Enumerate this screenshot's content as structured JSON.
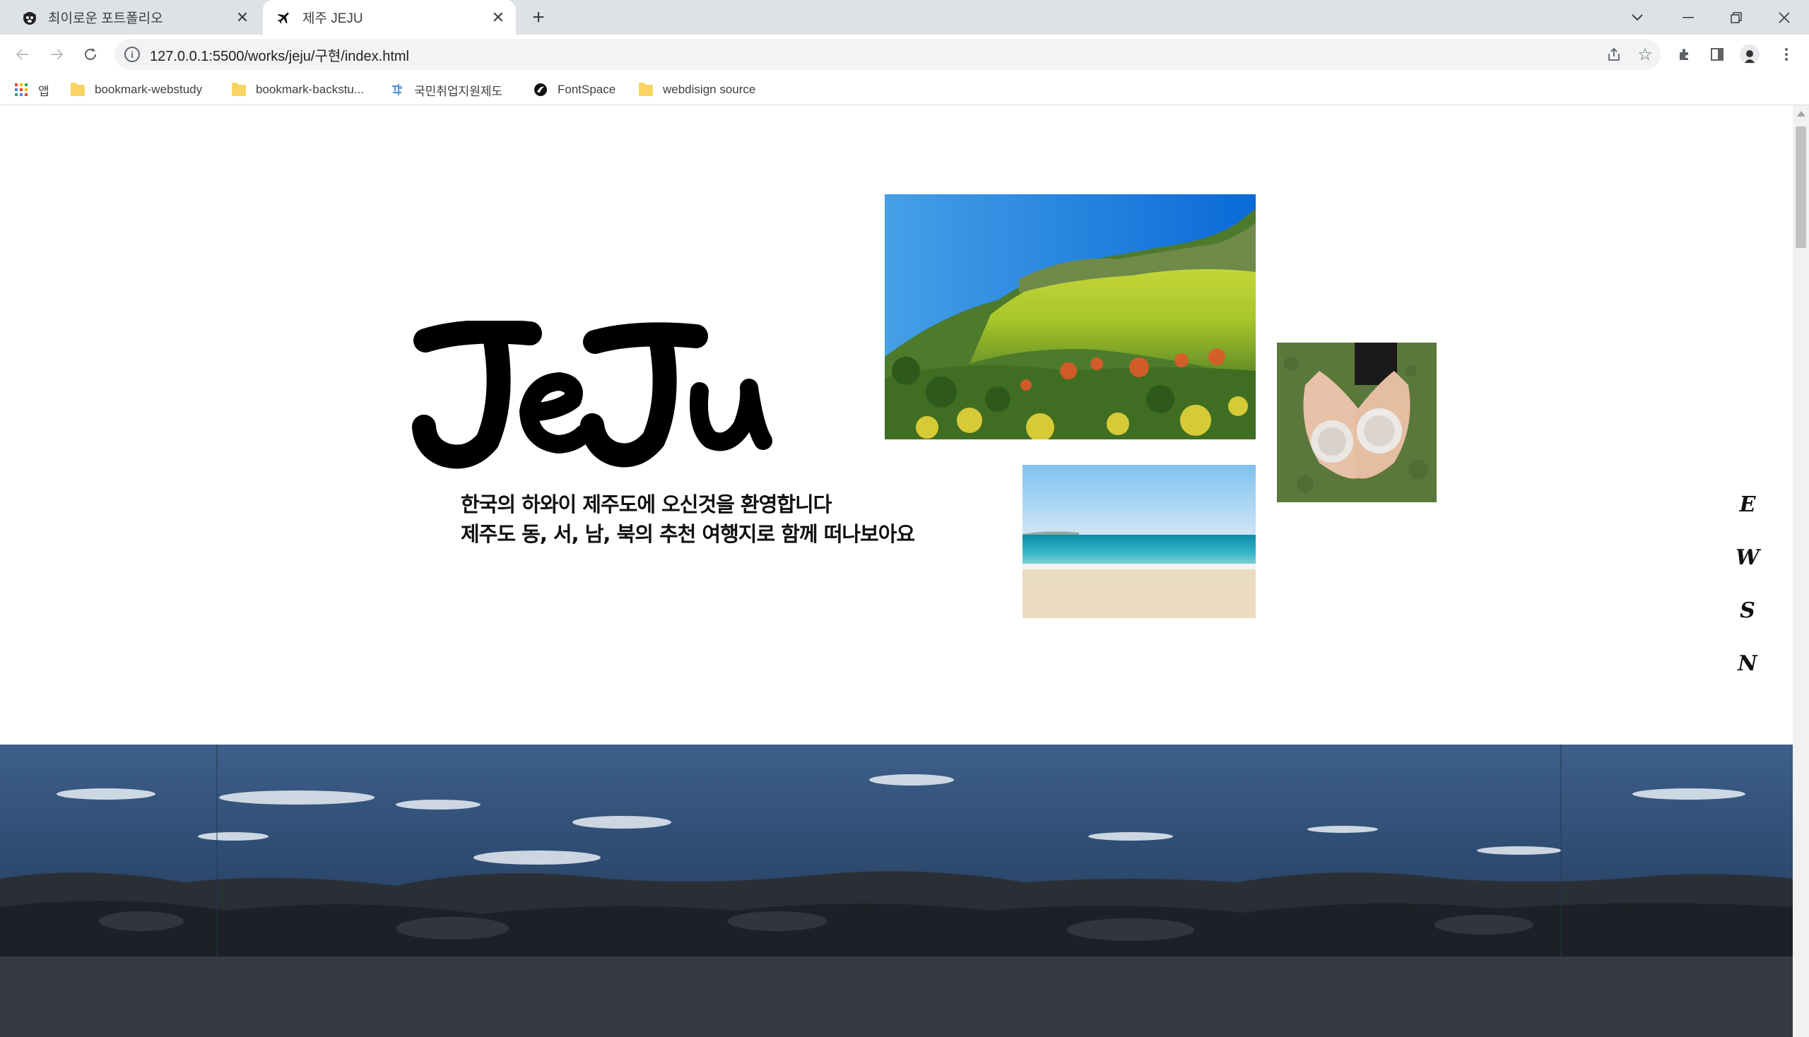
{
  "browser": {
    "tabs": [
      {
        "title": "최이로운 포트폴리오",
        "active": false,
        "icon": "cat-icon"
      },
      {
        "title": "제주 JEJU",
        "active": true,
        "icon": "airplane-icon"
      }
    ],
    "url": "127.0.0.1:5500/works/jeju/구현/index.html",
    "bookmarks": [
      {
        "label": "앱",
        "icon": "apps-grid-icon"
      },
      {
        "label": "bookmark-webstudy",
        "icon": "folder-icon"
      },
      {
        "label": "bookmark-backstu...",
        "icon": "folder-icon"
      },
      {
        "label": "국민취업지원제도",
        "icon": "site-icon"
      },
      {
        "label": "FontSpace",
        "icon": "fontspace-icon"
      },
      {
        "label": "webdisign source",
        "icon": "folder-icon"
      }
    ]
  },
  "hero": {
    "logo_text": "JeJu",
    "welcome_line1": "한국의 하와이 제주도에 오신것을 환영합니다",
    "welcome_line2": "제주도 동, 서, 남, 북의 추천 여행지로 함께 떠나보아요"
  },
  "direction_nav": [
    "E",
    "W",
    "S",
    "N"
  ],
  "colors": {
    "tabstrip": "#dee1e6",
    "footer_band": "#363a43",
    "text": "#111111"
  }
}
